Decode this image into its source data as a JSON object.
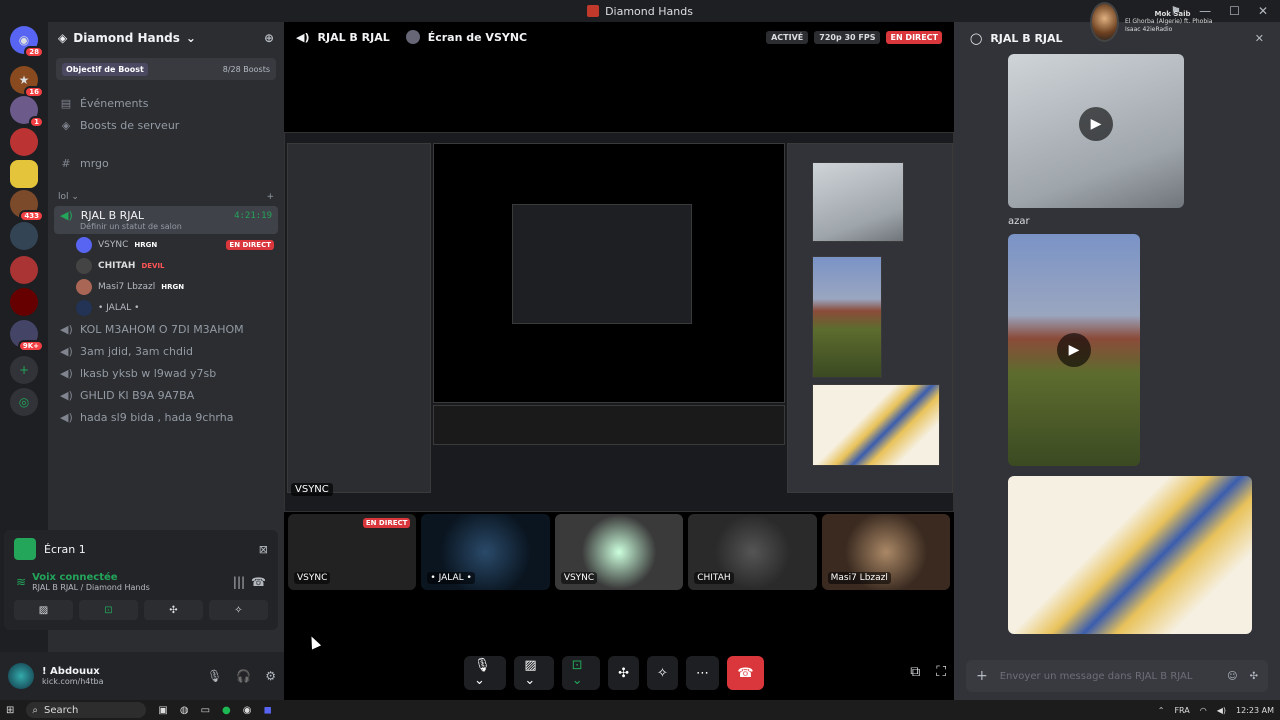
{
  "window": {
    "title": "Diamond Hands"
  },
  "notification": {
    "name": "Mok Saib",
    "text": "El Ghorba (Algerie) ft. Phobia Isaac 42ieRadio"
  },
  "servers": {
    "badges": [
      "28",
      "16",
      "1",
      "433",
      "9K+"
    ]
  },
  "guild": {
    "name": "Diamond Hands",
    "boost_label": "Objectif de Boost",
    "boost_count": "8/28 Boosts"
  },
  "channels": {
    "events": "Événements",
    "server_boosts": "Boosts de serveur",
    "text_channel": "mrgo",
    "category": "lol",
    "active_voice": {
      "name": "RJAL B RJAL",
      "time": "4:21:19",
      "status": "Définir un statut de salon"
    },
    "members": [
      {
        "name": "VSYNC",
        "tag": "HRGN",
        "live": "EN DIRECT"
      },
      {
        "name": "CHITAH",
        "tag": "DEVIL"
      },
      {
        "name": "Masi7 Lbzazl",
        "tag": "HRGN"
      },
      {
        "name": "• JALAL •"
      }
    ],
    "voice_channels": [
      "KOL M3AHOM O 7DI M3AHOM",
      "3am jdid, 3am chdid",
      "lkasb yksb w l9wad y7sb",
      "GHLID KI B9A 9A7BA",
      "hada sl9 bida , hada 9chrha"
    ]
  },
  "panel": {
    "title": "Écran 1",
    "connected": "Voix connectée",
    "location": "RJAL B RJAL / Diamond Hands"
  },
  "user": {
    "name": "! Abdouux",
    "status": "kick.com/h4tba"
  },
  "stage": {
    "channel": "RJAL B RJAL",
    "screen_of": "Écran de VSYNC",
    "active": "ACTIVÉ",
    "quality": "720p 30 FPS",
    "live": "EN DIRECT",
    "overlay_label": "VSYNC"
  },
  "tiles": [
    {
      "label": "VSYNC",
      "live": "EN DIRECT"
    },
    {
      "label": "• JALAL •"
    },
    {
      "label": "VSYNC"
    },
    {
      "label": "CHITAH"
    },
    {
      "label": "Masi7 Lbzazl"
    }
  ],
  "side": {
    "channel": "RJAL B RJAL",
    "caption": "azar",
    "placeholder": "Envoyer un message dans RJAL B RJAL"
  },
  "taskbar": {
    "search": "Search",
    "lang": "FRA",
    "time": "12:23 AM"
  }
}
